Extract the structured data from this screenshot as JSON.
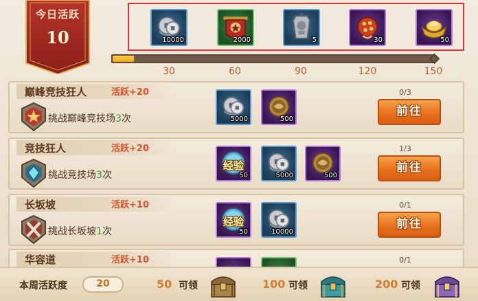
{
  "today": {
    "label": "今日活跃",
    "value": "10"
  },
  "milestones": [
    {
      "threshold": "30",
      "count": "10000",
      "item": "copper-coins-icon",
      "frame": "blue"
    },
    {
      "threshold": "60",
      "count": "2000",
      "item": "war-banner-icon",
      "frame": "green"
    },
    {
      "threshold": "90",
      "count": "5",
      "item": "silver-token-icon",
      "frame": "blue"
    },
    {
      "threshold": "120",
      "count": "30",
      "item": "red-orb-icon",
      "frame": "purple"
    },
    {
      "threshold": "150",
      "count": "50",
      "item": "gold-ingot-icon",
      "frame": "purple"
    }
  ],
  "progress": {
    "current": 10,
    "max": 150,
    "fraction": 0.067
  },
  "tasks": [
    {
      "name": "巅峰竞技狂人",
      "points": "活跃+20",
      "desc_prefix": "挑战巅峰竞技场",
      "desc_count": "3",
      "desc_suffix": "次",
      "progress": "0/3",
      "button": "前往",
      "emblem": "red-star-emblem-icon",
      "rewards": [
        {
          "count": "5000",
          "item": "copper-coins-icon",
          "frame": "blue"
        },
        {
          "count": "500",
          "item": "bronze-medal-icon",
          "frame": "purple"
        }
      ]
    },
    {
      "name": "竞技狂人",
      "points": "活跃+20",
      "desc_prefix": "挑战竞技场",
      "desc_count": "3",
      "desc_suffix": "次",
      "progress": "1/3",
      "button": "前往",
      "emblem": "blue-gem-emblem-icon",
      "rewards": [
        {
          "count": "50",
          "item": "experience-icon",
          "label": "经验",
          "frame": "purple"
        },
        {
          "count": "5000",
          "item": "copper-coins-icon",
          "frame": "blue"
        },
        {
          "count": "500",
          "item": "bronze-medal-icon",
          "frame": "purple"
        }
      ]
    },
    {
      "name": "长坂坡",
      "points": "活跃+10",
      "desc_prefix": "挑战长坂坡",
      "desc_count": "1",
      "desc_suffix": "次",
      "progress": "0/1",
      "button": "前往",
      "emblem": "crossed-swords-emblem-icon",
      "rewards": [
        {
          "count": "50",
          "item": "experience-icon",
          "label": "经验",
          "frame": "purple"
        },
        {
          "count": "10000",
          "item": "copper-coins-icon",
          "frame": "blue"
        }
      ]
    },
    {
      "name": "华容道",
      "points": "活跃+10",
      "progress": "0/1",
      "rewards": [
        {
          "item": "partial-reward-icon",
          "frame": "purple"
        },
        {
          "item": "partial-reward-icon",
          "frame": "green"
        }
      ]
    }
  ],
  "weekly": {
    "label": "本周活跃度",
    "value": "20",
    "chests": [
      {
        "points": "50",
        "claim": "可领",
        "item": "bronze-chest-icon"
      },
      {
        "points": "100",
        "claim": "可领",
        "item": "teal-chest-icon"
      },
      {
        "points": "200",
        "claim": "可领",
        "item": "purple-chest-icon"
      }
    ]
  },
  "colors": {
    "accent": "#e8721e",
    "points_red": "#d1542e",
    "count_green": "#2f9a2f",
    "highlight_box": "#d9343a"
  }
}
